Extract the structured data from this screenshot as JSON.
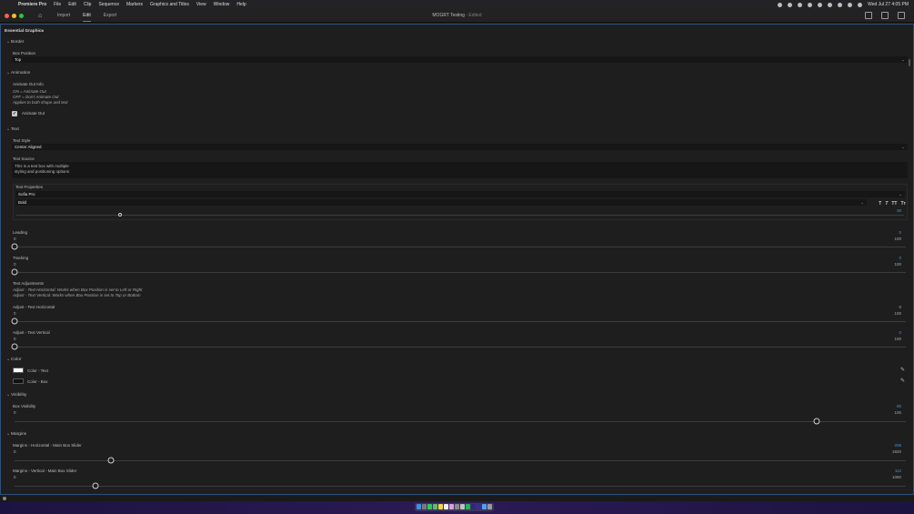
{
  "menubar": {
    "app_name": "Premiere Pro",
    "items": [
      "File",
      "Edit",
      "Clip",
      "Sequence",
      "Markers",
      "Graphics and Titles",
      "View",
      "Window",
      "Help"
    ],
    "clock": "Wed Jul 27  4:05 PM"
  },
  "header": {
    "tabs": [
      {
        "label": "Import"
      },
      {
        "label": "Edit"
      },
      {
        "label": "Export"
      }
    ],
    "project_title": "MOGRT Testing",
    "project_status": " - Edited"
  },
  "panel": {
    "title": "Essential Graphics",
    "menu": "≡"
  },
  "border": {
    "section": "Border",
    "box_position_label": "Box Position",
    "box_position_value": "Top"
  },
  "animation": {
    "section": "Animation",
    "info_label": "Animate Out Info",
    "info_line1": "ON = Animate Out",
    "info_line2": "OFF = Don't Animate Out",
    "info_line3": "Applies to both shape and text",
    "checkbox_label": "Animate Out",
    "checked": true
  },
  "text": {
    "section": "Text",
    "style_label": "Text Style",
    "style_value": "Center Aligned",
    "source_label": "Text Source",
    "source_line1": "This is a text box with multiple",
    "source_line2": "styling and positioning options",
    "props_label": "Text Properties",
    "font_family": "Sofia Pro",
    "font_style": "Bold",
    "font_size": "38",
    "font_size_fraction": 0.118,
    "font_icons": [
      "T",
      "T",
      "TT",
      "Tт"
    ]
  },
  "leading": {
    "label": "Leading",
    "value": "0",
    "min": "0",
    "max": "100",
    "fraction": 0.0
  },
  "tracking": {
    "label": "Tracking",
    "value": "0",
    "min": "0",
    "max": "100",
    "fraction": 0.0
  },
  "adjustments": {
    "label": "Text Adjustments",
    "line1": "Adjust - Text Horizontal: Works when Box Position is set to Left or Right",
    "line2": "Adjust - Text Vertical: Works when Box Position is set to Top or Bottom"
  },
  "adjust_h": {
    "label": "Adjust - Text Horizontal",
    "value": "0",
    "min": "0",
    "max": "100",
    "fraction": 0.0
  },
  "adjust_v": {
    "label": "Adjust - Text Vertical",
    "value": "0",
    "min": "0",
    "max": "100",
    "fraction": 0.0
  },
  "color": {
    "section": "Color",
    "text_label": "Color - Text",
    "text_color": "#ffffff",
    "box_label": "Color - Box",
    "box_color": "#111111"
  },
  "visibility": {
    "section": "Visibility",
    "box_label": "Box Visibility",
    "value": "90",
    "min": "0",
    "max": "100",
    "fraction": 0.9
  },
  "margins": {
    "section": "Margins",
    "h_label": "Margins - Horizontal - Main Box Slider",
    "h_value": "208",
    "h_min": "0",
    "h_max": "1920",
    "h_fraction": 0.108,
    "v_label": "Margins - Vertical - Main Box Slider",
    "v_value": "112",
    "v_min": "0",
    "v_max": "1080",
    "v_fraction": 0.0905
  },
  "colors": {
    "accent": "#4a90e2",
    "panel_border": "#2f4f7a",
    "traffic_red": "#ff5f57",
    "traffic_yellow": "#febc2e",
    "traffic_green": "#28c840"
  }
}
